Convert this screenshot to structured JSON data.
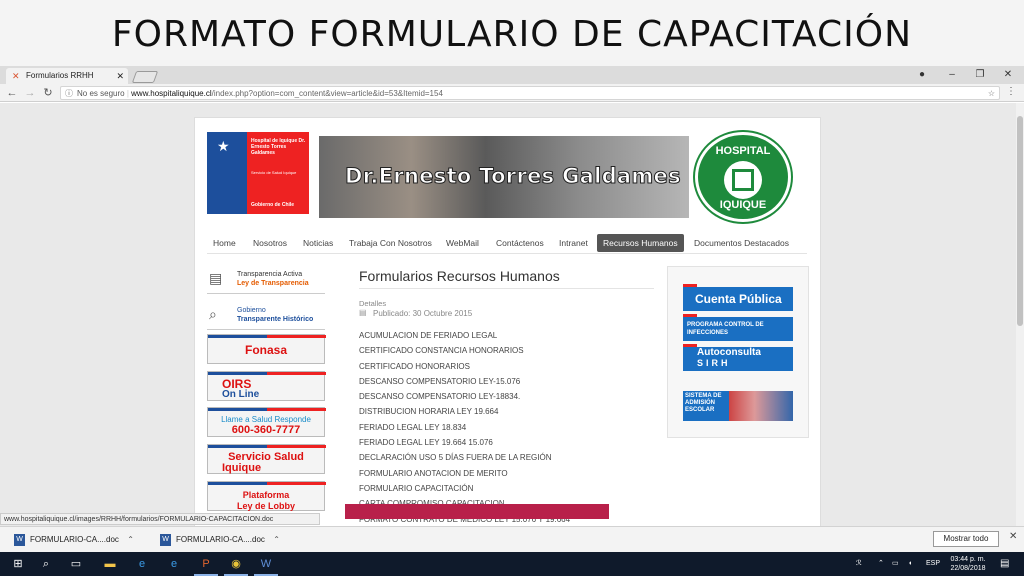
{
  "slide_title": "FORMATO FORMULARIO DE CAPACITACIÓN",
  "browser": {
    "tab_title": "Formularios RRHH",
    "security": "No es seguro",
    "url_domain": "www.hospitaliquique.cl",
    "url_rest": "/index.php?option=com_content&view=article&id=53&Itemid=154",
    "status_url": "www.hospitaliquique.cl/images/RRHH/formularios/FORMULARIO-CAPACITACION.doc"
  },
  "site": {
    "gob": {
      "line1": "Hospital de Iquique Dr. Ernesto Torres Galdames",
      "line2": "Servicio de Salud Iquique",
      "line3": "Gobierno de Chile"
    },
    "banner_name": "Dr.Ernesto Torres Galdames",
    "logo_top": "HOSPITAL",
    "logo_bottom": "IQUIQUE",
    "menu": [
      "Home",
      "Nosotros",
      "Noticias",
      "Trabaja Con Nosotros",
      "WebMail",
      "Contáctenos",
      "Intranet",
      "Recursos Humanos",
      "Documentos Destacados"
    ],
    "left": {
      "transp_a": "Transparencia Activa",
      "transp_b": "Ley de Transparencia",
      "gob_a": "Gobierno",
      "gob_b": "Transparente Histórico",
      "fonasa": "Fonasa",
      "oirs_a": "OIRS",
      "oirs_b": "On Line",
      "salud_a": "Llame a Salud Responde",
      "salud_b": "600-360-7777",
      "ssi_a": "Servicio Salud",
      "ssi_b": "Iquique",
      "lobby_a": "Plataforma",
      "lobby_b": "Ley de Lobby"
    },
    "article": {
      "title": "Formularios Recursos Humanos",
      "details": "Detalles",
      "published": "Publicado: 30 Octubre 2015",
      "files": [
        "ACUMULACION DE FERIADO LEGAL",
        "CERTIFICADO CONSTANCIA HONORARIOS",
        "CERTIFICADO HONORARIOS",
        "DESCANSO COMPENSATORIO LEY-15.076",
        "DESCANSO COMPENSATORIO LEY-18834.",
        "DISTRIBUCION HORARIA LEY 19.664",
        "FERIADO LEGAL LEY 18.834",
        "FERIADO LEGAL LEY 19.664 15.076",
        "DECLARACIÓN USO 5 DÍAS FUERA DE LA REGIÓN",
        "FORMULARIO ANOTACION DE MERITO",
        "FORMULARIO CAPACITACIÓN",
        "CARTA COMPROMISO CAPACITACION",
        "FORMATO CONTRATO DE MEDICO LEY 15.076 Y 19.664"
      ]
    },
    "right": {
      "cuenta": "Cuenta Pública",
      "iaas": "PROGRAMA CONTROL DE INFECCIONES",
      "sirh_a": "Autoconsulta",
      "sirh_b": "SIRH",
      "adm": "SISTEMA DE ADMISIÓN ESCOLAR"
    }
  },
  "downloads": {
    "item1": "FORMULARIO-CA....doc",
    "item2": "FORMULARIO-CA....doc",
    "show_all": "Mostrar todo"
  },
  "taskbar": {
    "lang": "ESP",
    "time": "03:44 p. m.",
    "date": "22/08/2018"
  }
}
